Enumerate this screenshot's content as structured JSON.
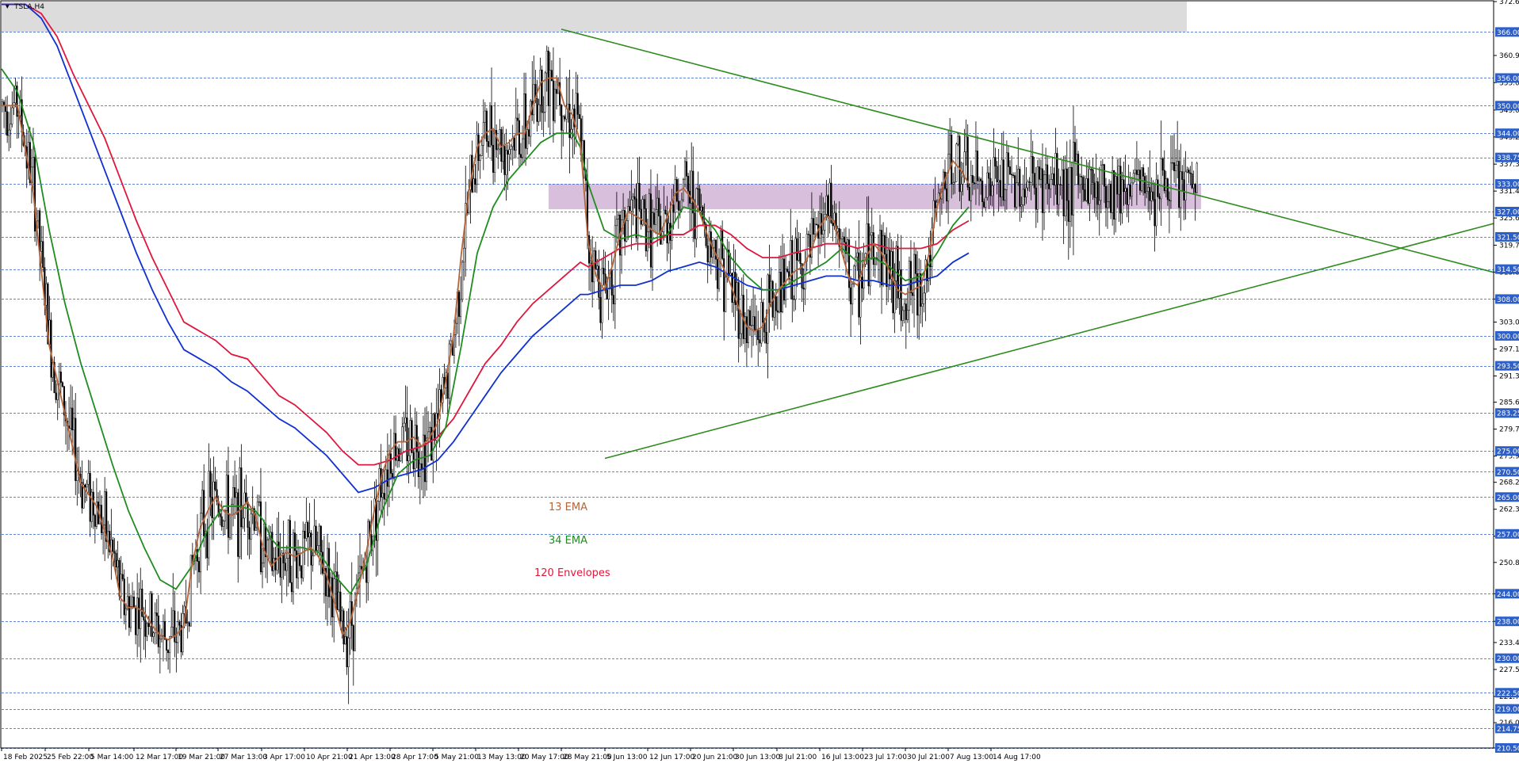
{
  "window": {
    "title": "TSLA,H4",
    "menu_icon": "triangle-down-icon"
  },
  "chart_data": {
    "type": "candlestick",
    "symbol": "TSLA",
    "timeframe": "H4",
    "ylim": [
      210.5,
      372.6
    ],
    "grid": "dashed blue horizontal lines at marked levels",
    "price_axis_ticks": [
      372.6,
      360.9,
      355.0,
      349.05,
      343.2,
      337.3,
      331.45,
      325.6,
      319.7,
      313.85,
      308.0,
      303.0,
      297.15,
      291.3,
      285.6,
      279.75,
      273.9,
      268.2,
      262.35,
      256.5,
      250.8,
      244.0,
      238.0,
      233.4,
      227.55,
      221.7,
      216.0,
      210.5
    ],
    "level_lines": [
      366.0,
      356.0,
      350.0,
      344.0,
      338.75,
      333.0,
      327.0,
      321.5,
      314.5,
      308.0,
      300.0,
      293.5,
      283.25,
      275.0,
      270.5,
      265.0,
      257.0,
      244.0,
      238.0,
      230.0,
      222.5,
      219.0,
      214.75,
      210.5
    ],
    "time_axis_labels": [
      "18 Feb 2025",
      "25 Feb 22:00",
      "5 Mar 14:00",
      "12 Mar 17:00",
      "19 Mar 21:00",
      "27 Mar 13:00",
      "3 Apr 17:00",
      "10 Apr 21:00",
      "21 Apr 13:00",
      "28 Apr 17:00",
      "5 May 21:00",
      "13 May 13:00",
      "20 May 17:00",
      "28 May 21:00",
      "5 Jun 13:00",
      "12 Jun 17:00",
      "20 Jun 21:00",
      "30 Jun 13:00",
      "8 Jul 21:00",
      "16 Jul 13:00",
      "23 Jul 17:00",
      "30 Jul 21:00",
      "7 Aug 13:00",
      "14 Aug 17:00"
    ],
    "zones": [
      {
        "from": 366.0,
        "to": 372.6,
        "color": "#dcdcdc"
      },
      {
        "from": 327.5,
        "to": 333.0,
        "color": "#d8c0dc"
      }
    ],
    "trendlines": [
      {
        "from": [
          "28 May 21:00",
          366.6
        ],
        "to": [
          "right-edge",
          313.8
        ],
        "color": "#2e8b1e"
      },
      {
        "from": [
          "5 Jun 13:00",
          273.4
        ],
        "to": [
          "right-edge",
          324.4
        ],
        "color": "#2e8b1e"
      }
    ],
    "series": [
      {
        "name": "13 EMA",
        "color": "#b5643a"
      },
      {
        "name": "34 EMA",
        "color": "#1f8c1f"
      },
      {
        "name": "120 Envelopes",
        "color": "#e0173c"
      },
      {
        "color": "#1030d0"
      }
    ],
    "path_points": {
      "ema13": [
        [
          0,
          350
        ],
        [
          20,
          350
        ],
        [
          40,
          331
        ],
        [
          60,
          298
        ],
        [
          80,
          283
        ],
        [
          100,
          268
        ],
        [
          120,
          263
        ],
        [
          140,
          252
        ],
        [
          150,
          243
        ],
        [
          160,
          241
        ],
        [
          170,
          241
        ],
        [
          180,
          240
        ],
        [
          190,
          237
        ],
        [
          200,
          235
        ],
        [
          210,
          234
        ],
        [
          220,
          235
        ],
        [
          230,
          237
        ],
        [
          240,
          250
        ],
        [
          250,
          258
        ],
        [
          260,
          262
        ],
        [
          270,
          265
        ],
        [
          280,
          262
        ],
        [
          290,
          261
        ],
        [
          300,
          262
        ],
        [
          310,
          264
        ],
        [
          320,
          261
        ],
        [
          330,
          254
        ],
        [
          340,
          250
        ],
        [
          350,
          252
        ],
        [
          360,
          253
        ],
        [
          370,
          252
        ],
        [
          380,
          253
        ],
        [
          390,
          254
        ],
        [
          400,
          252
        ],
        [
          410,
          248
        ],
        [
          420,
          242
        ],
        [
          430,
          235
        ],
        [
          440,
          238
        ],
        [
          450,
          245
        ],
        [
          460,
          253
        ],
        [
          470,
          262
        ],
        [
          480,
          270
        ],
        [
          490,
          275
        ],
        [
          500,
          277
        ],
        [
          510,
          277
        ],
        [
          520,
          278
        ],
        [
          530,
          276
        ],
        [
          540,
          278
        ],
        [
          550,
          281
        ],
        [
          560,
          290
        ],
        [
          570,
          300
        ],
        [
          580,
          318
        ],
        [
          590,
          332
        ],
        [
          600,
          341
        ],
        [
          610,
          344
        ],
        [
          620,
          345
        ],
        [
          630,
          341
        ],
        [
          640,
          342
        ],
        [
          650,
          344
        ],
        [
          660,
          344
        ],
        [
          670,
          350
        ],
        [
          680,
          355
        ],
        [
          690,
          356
        ],
        [
          700,
          356
        ],
        [
          710,
          350
        ],
        [
          720,
          348
        ],
        [
          730,
          342
        ],
        [
          740,
          320
        ],
        [
          750,
          313
        ],
        [
          760,
          310
        ],
        [
          770,
          315
        ],
        [
          780,
          322
        ],
        [
          790,
          327
        ],
        [
          800,
          326
        ],
        [
          810,
          325
        ],
        [
          820,
          323
        ],
        [
          830,
          322
        ],
        [
          840,
          326
        ],
        [
          850,
          331
        ],
        [
          860,
          332
        ],
        [
          870,
          330
        ],
        [
          880,
          327
        ],
        [
          890,
          322
        ],
        [
          900,
          318
        ],
        [
          910,
          315
        ],
        [
          920,
          311
        ],
        [
          930,
          306
        ],
        [
          940,
          302
        ],
        [
          950,
          301
        ],
        [
          960,
          302
        ],
        [
          970,
          307
        ],
        [
          980,
          310
        ],
        [
          990,
          312
        ],
        [
          1000,
          314
        ],
        [
          1010,
          315
        ],
        [
          1020,
          318
        ],
        [
          1030,
          323
        ],
        [
          1040,
          326
        ],
        [
          1050,
          325
        ],
        [
          1060,
          318
        ],
        [
          1070,
          312
        ],
        [
          1080,
          311
        ],
        [
          1090,
          317
        ],
        [
          1100,
          320
        ],
        [
          1110,
          318
        ],
        [
          1120,
          314
        ],
        [
          1130,
          310
        ],
        [
          1140,
          309
        ],
        [
          1150,
          310
        ],
        [
          1160,
          311
        ],
        [
          1170,
          318
        ],
        [
          1180,
          328
        ],
        [
          1190,
          334
        ],
        [
          1200,
          338
        ],
        [
          1210,
          336
        ],
        [
          1220,
          333
        ]
      ],
      "ema34": [
        [
          0,
          358
        ],
        [
          20,
          353
        ],
        [
          40,
          342
        ],
        [
          60,
          323
        ],
        [
          80,
          307
        ],
        [
          100,
          294
        ],
        [
          120,
          283
        ],
        [
          140,
          272
        ],
        [
          160,
          262
        ],
        [
          180,
          254
        ],
        [
          200,
          247
        ],
        [
          220,
          245
        ],
        [
          240,
          250
        ],
        [
          260,
          258
        ],
        [
          280,
          263
        ],
        [
          300,
          263
        ],
        [
          320,
          262
        ],
        [
          330,
          260
        ],
        [
          340,
          256
        ],
        [
          350,
          254
        ],
        [
          360,
          254
        ],
        [
          380,
          254
        ],
        [
          400,
          253
        ],
        [
          420,
          248
        ],
        [
          440,
          244
        ],
        [
          460,
          250
        ],
        [
          480,
          262
        ],
        [
          500,
          270
        ],
        [
          520,
          273
        ],
        [
          540,
          274
        ],
        [
          560,
          280
        ],
        [
          580,
          298
        ],
        [
          600,
          318
        ],
        [
          620,
          328
        ],
        [
          640,
          334
        ],
        [
          660,
          338
        ],
        [
          680,
          342
        ],
        [
          700,
          344
        ],
        [
          720,
          344
        ],
        [
          730,
          341
        ],
        [
          740,
          333
        ],
        [
          760,
          323
        ],
        [
          780,
          321
        ],
        [
          800,
          322
        ],
        [
          820,
          321
        ],
        [
          840,
          322
        ],
        [
          860,
          328
        ],
        [
          880,
          327
        ],
        [
          900,
          323
        ],
        [
          920,
          317
        ],
        [
          940,
          313
        ],
        [
          960,
          310
        ],
        [
          980,
          310
        ],
        [
          1000,
          312
        ],
        [
          1020,
          314
        ],
        [
          1040,
          316
        ],
        [
          1060,
          319
        ],
        [
          1080,
          316
        ],
        [
          1100,
          317
        ],
        [
          1120,
          315
        ],
        [
          1140,
          312
        ],
        [
          1160,
          313
        ],
        [
          1180,
          318
        ],
        [
          1200,
          324
        ],
        [
          1220,
          328
        ]
      ],
      "envelope_upper": [
        [
          0,
          372
        ],
        [
          30,
          372
        ],
        [
          50,
          370
        ],
        [
          70,
          365
        ],
        [
          90,
          357
        ],
        [
          110,
          350
        ],
        [
          130,
          343
        ],
        [
          150,
          334
        ],
        [
          170,
          325
        ],
        [
          190,
          317
        ],
        [
          210,
          310
        ],
        [
          230,
          303
        ],
        [
          250,
          301
        ],
        [
          270,
          299
        ],
        [
          290,
          296
        ],
        [
          310,
          295
        ],
        [
          330,
          291
        ],
        [
          350,
          287
        ],
        [
          370,
          285
        ],
        [
          390,
          282
        ],
        [
          410,
          279
        ],
        [
          430,
          275
        ],
        [
          450,
          272
        ],
        [
          470,
          272
        ],
        [
          490,
          273
        ],
        [
          510,
          275
        ],
        [
          530,
          276
        ],
        [
          550,
          278
        ],
        [
          570,
          282
        ],
        [
          590,
          288
        ],
        [
          610,
          294
        ],
        [
          630,
          298
        ],
        [
          650,
          303
        ],
        [
          670,
          307
        ],
        [
          690,
          310
        ],
        [
          710,
          313
        ],
        [
          730,
          316
        ],
        [
          740,
          315
        ],
        [
          760,
          317
        ],
        [
          780,
          319
        ],
        [
          800,
          320
        ],
        [
          820,
          320
        ],
        [
          840,
          322
        ],
        [
          860,
          322
        ],
        [
          880,
          324
        ],
        [
          900,
          324
        ],
        [
          920,
          322
        ],
        [
          940,
          319
        ],
        [
          960,
          317
        ],
        [
          980,
          317
        ],
        [
          1000,
          318
        ],
        [
          1020,
          319
        ],
        [
          1040,
          320
        ],
        [
          1060,
          320
        ],
        [
          1080,
          319
        ],
        [
          1100,
          320
        ],
        [
          1120,
          319
        ],
        [
          1140,
          319
        ],
        [
          1160,
          319
        ],
        [
          1180,
          320
        ],
        [
          1200,
          323
        ],
        [
          1220,
          325
        ]
      ],
      "envelope_lower": [
        [
          0,
          372
        ],
        [
          30,
          372
        ],
        [
          50,
          369
        ],
        [
          70,
          363
        ],
        [
          90,
          354
        ],
        [
          110,
          345
        ],
        [
          130,
          336
        ],
        [
          150,
          327
        ],
        [
          170,
          318
        ],
        [
          190,
          310
        ],
        [
          210,
          303
        ],
        [
          230,
          297
        ],
        [
          250,
          295
        ],
        [
          270,
          293
        ],
        [
          290,
          290
        ],
        [
          310,
          288
        ],
        [
          330,
          285
        ],
        [
          350,
          282
        ],
        [
          370,
          280
        ],
        [
          390,
          277
        ],
        [
          410,
          274
        ],
        [
          430,
          270
        ],
        [
          450,
          266
        ],
        [
          470,
          267
        ],
        [
          490,
          269
        ],
        [
          510,
          270
        ],
        [
          530,
          271
        ],
        [
          550,
          273
        ],
        [
          570,
          277
        ],
        [
          590,
          282
        ],
        [
          610,
          287
        ],
        [
          630,
          292
        ],
        [
          650,
          296
        ],
        [
          670,
          300
        ],
        [
          690,
          303
        ],
        [
          710,
          306
        ],
        [
          730,
          309
        ],
        [
          740,
          309
        ],
        [
          760,
          310
        ],
        [
          780,
          311
        ],
        [
          800,
          311
        ],
        [
          820,
          312
        ],
        [
          840,
          314
        ],
        [
          860,
          315
        ],
        [
          880,
          316
        ],
        [
          900,
          315
        ],
        [
          920,
          313
        ],
        [
          940,
          311
        ],
        [
          960,
          310
        ],
        [
          980,
          310
        ],
        [
          1000,
          311
        ],
        [
          1020,
          312
        ],
        [
          1040,
          313
        ],
        [
          1060,
          313
        ],
        [
          1080,
          312
        ],
        [
          1100,
          312
        ],
        [
          1120,
          311
        ],
        [
          1140,
          311
        ],
        [
          1160,
          312
        ],
        [
          1180,
          313
        ],
        [
          1200,
          316
        ],
        [
          1220,
          318
        ]
      ]
    }
  }
}
